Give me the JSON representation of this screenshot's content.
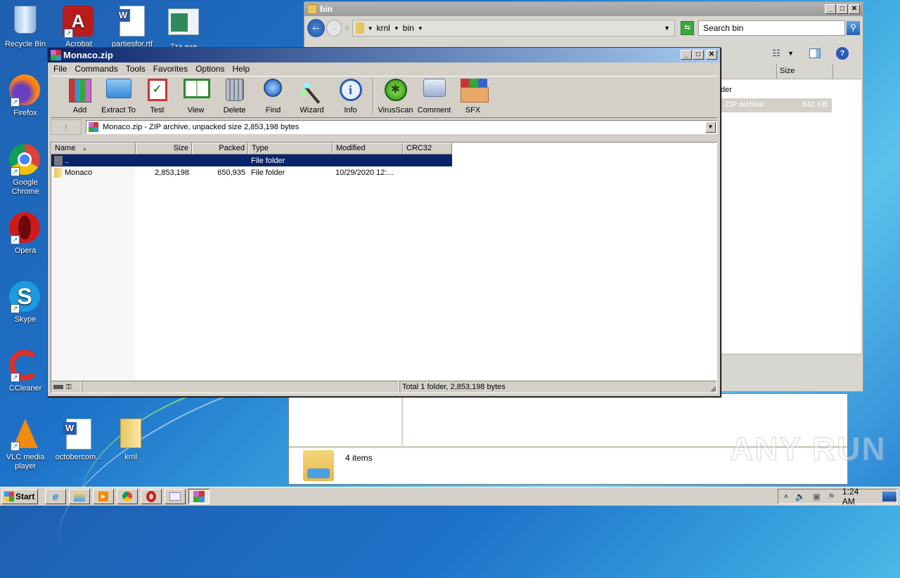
{
  "desktop": {
    "icons": [
      {
        "label": "Recycle Bin",
        "icon": "recycle-bin-icon"
      },
      {
        "label": "Acrobat",
        "icon": "acrobat-icon"
      },
      {
        "label": "partiesfor.rtf",
        "icon": "word-doc-icon"
      },
      {
        "label": "7za.exe",
        "icon": "exe-icon"
      },
      {
        "label": "Firefox",
        "icon": "firefox-icon"
      },
      {
        "label": "Google Chrome",
        "icon": "chrome-icon"
      },
      {
        "label": "Opera",
        "icon": "opera-icon"
      },
      {
        "label": "Skype",
        "icon": "skype-icon"
      },
      {
        "label": "CCleaner",
        "icon": "ccleaner-icon"
      },
      {
        "label": "VLC media player",
        "icon": "vlc-icon"
      },
      {
        "label": "octobercom...",
        "icon": "word-doc-icon"
      },
      {
        "label": "krnl",
        "icon": "folder-icon"
      }
    ]
  },
  "explorer": {
    "title": "bin",
    "breadcrumb": [
      "krnl",
      "bin"
    ],
    "search_placeholder": "Search bin",
    "columns": {
      "size": "Size"
    },
    "partial_row_1": "der",
    "partial_row_2_type": "ZIP archive",
    "partial_row_2_size": "642 KB",
    "details_count": "4 items"
  },
  "winrar": {
    "title": "Monaco.zip",
    "menu": [
      "File",
      "Commands",
      "Tools",
      "Favorites",
      "Options",
      "Help"
    ],
    "toolbar": [
      {
        "label": "Add",
        "icon": "add-archive-icon"
      },
      {
        "label": "Extract To",
        "icon": "extract-folder-icon"
      },
      {
        "label": "Test",
        "icon": "test-clipboard-icon"
      },
      {
        "label": "View",
        "icon": "view-book-icon"
      },
      {
        "label": "Delete",
        "icon": "trash-icon"
      },
      {
        "label": "Find",
        "icon": "magnifier-icon"
      },
      {
        "label": "Wizard",
        "icon": "wizard-wand-icon"
      },
      {
        "label": "Info",
        "icon": "info-icon"
      },
      {
        "label": "VirusScan",
        "icon": "virus-scan-icon"
      },
      {
        "label": "Comment",
        "icon": "comment-icon"
      },
      {
        "label": "SFX",
        "icon": "sfx-box-icon"
      }
    ],
    "address": "Monaco.zip - ZIP archive, unpacked size 2,853,198 bytes",
    "columns": [
      "Name",
      "Size",
      "Packed",
      "Type",
      "Modified",
      "CRC32"
    ],
    "rows": [
      {
        "name": "..",
        "size": "",
        "packed": "",
        "type": "File folder",
        "modified": "",
        "crc": "",
        "selected": true
      },
      {
        "name": "Monaco",
        "size": "2,853,198",
        "packed": "650,935",
        "type": "File folder",
        "modified": "10/29/2020 12:...",
        "crc": "",
        "selected": false
      }
    ],
    "status_total": "Total 1 folder, 2,853,198 bytes"
  },
  "taskbar": {
    "start_label": "Start",
    "buttons": [
      "internet-explorer",
      "windows-explorer",
      "media-player",
      "chrome",
      "opera",
      "7za",
      "winrar"
    ],
    "clock": "1:24 AM"
  },
  "watermark": "ANY RUN"
}
